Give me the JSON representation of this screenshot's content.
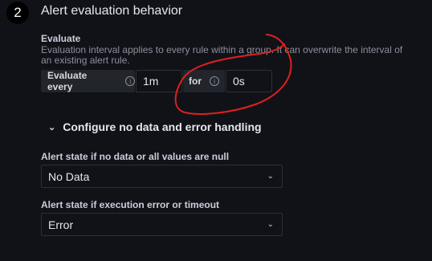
{
  "section": {
    "step_number": "2",
    "title": "Alert evaluation behavior"
  },
  "evaluate": {
    "heading": "Evaluate",
    "description": "Evaluation interval applies to every rule within a group. It can overwrite the interval of an existing alert rule.",
    "every_label": "Evaluate every",
    "every_value": "1m",
    "for_label": "for",
    "for_value": "0s"
  },
  "no_data": {
    "collapse_label": "Configure no data and error handling",
    "nodata_label": "Alert state if no data or all values are null",
    "nodata_value": "No Data",
    "error_label": "Alert state if execution error or timeout",
    "error_value": "Error"
  },
  "icons": {
    "info": "info-icon",
    "collapse": "chevron-down-icon",
    "select_arrow": "chevron-down-icon"
  },
  "colors": {
    "background": "#111217",
    "annotation": "#e0201f"
  }
}
